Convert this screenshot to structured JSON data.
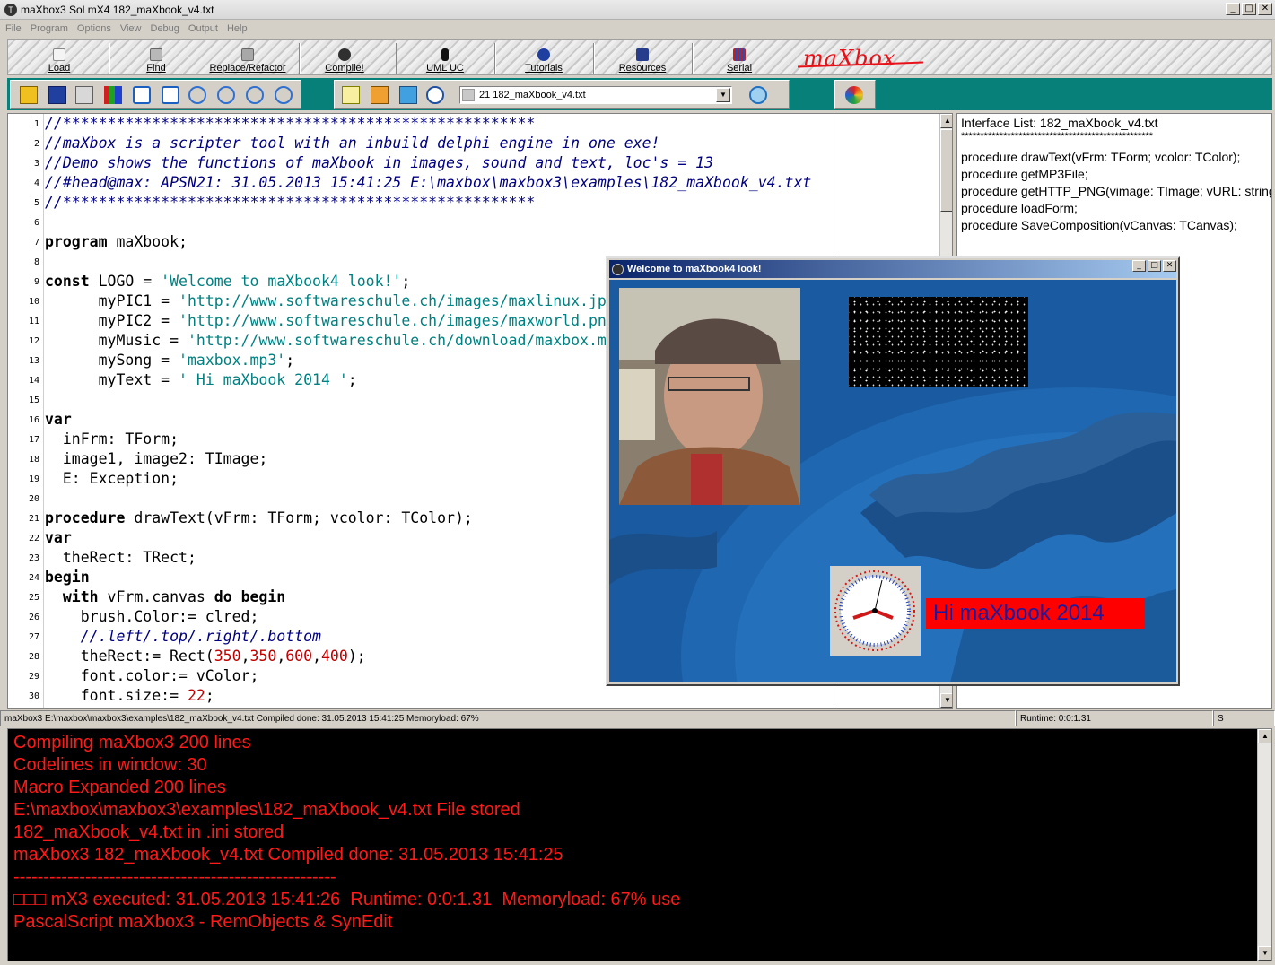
{
  "window": {
    "title": "maXbox3 Sol mX4  182_maXbook_v4.txt",
    "controls": [
      "_",
      "□",
      "✕"
    ]
  },
  "menu": [
    "File",
    "Program",
    "Options",
    "View",
    "Debug",
    "Output",
    "Help"
  ],
  "big_toolbar": {
    "buttons": [
      {
        "label": "Load",
        "icon": "load-icon"
      },
      {
        "label": "Find",
        "icon": "find-icon"
      },
      {
        "label": "Replace/Refactor",
        "icon": "replace-icon"
      },
      {
        "label": "Compile!",
        "icon": "compile-icon"
      },
      {
        "label": "UML UC",
        "icon": "uml-icon"
      },
      {
        "label": "Tutorials",
        "icon": "tutorials-icon"
      },
      {
        "label": "Resources",
        "icon": "resources-icon"
      },
      {
        "label": "Serial",
        "icon": "serial-icon"
      }
    ],
    "logo": "maXbox"
  },
  "teal_toolbar": {
    "file_combo": "21  182_maXbook_v4.txt",
    "accent": "#08807a"
  },
  "editor": {
    "line_numbers": [
      "1",
      "2",
      "3",
      "4",
      "5",
      "6",
      "7",
      "8",
      "9",
      "10",
      "11",
      "12",
      "13",
      "14",
      "15",
      "16",
      "17",
      "18",
      "19",
      "20",
      "21",
      "22",
      "23",
      "24",
      "25",
      "26",
      "27",
      "28",
      "29",
      "30"
    ]
  },
  "interface_list": {
    "title": "Interface List: 182_maXbook_v4.txt",
    "separator": "**************************************************",
    "items": [
      "procedure drawText(vFrm: TForm; vcolor: TColor);",
      "procedure getMP3File;",
      "procedure getHTTP_PNG(vimage: TImage; vURL: string);",
      "procedure loadForm;",
      "procedure SaveComposition(vCanvas: TCanvas);"
    ]
  },
  "statusbar": {
    "path": "maXbox3 E:\\maxbox\\maxbox3\\examples\\182_maXbook_v4.txt Compiled done: 31.05.2013 15:41:25  Memoryload: 67%",
    "runtime": "Runtime: 0:0:1.31",
    "mode": "S"
  },
  "console": {
    "lines": [
      "Compiling maXbox3 200 lines",
      "Codelines in window: 30",
      "Macro Expanded 200 lines",
      "E:\\maxbox\\maxbox3\\examples\\182_maXbook_v4.txt File stored",
      "182_maXbook_v4.txt in .ini stored",
      "maXbox3 182_maXbook_v4.txt Compiled done: 31.05.2013 15:41:25",
      "------------------------------------------------------",
      "□□□ mX3 executed: 31.05.2013 15:41:26  Runtime: 0:0:1.31  Memoryload: 67% use",
      "PascalScript maXbox3 - RemObjects & SynEdit"
    ],
    "text_color": "#ff1a1a"
  },
  "child_window": {
    "title": "Welcome to maXbook4 look!",
    "label": "Hi maXbook 2014"
  }
}
